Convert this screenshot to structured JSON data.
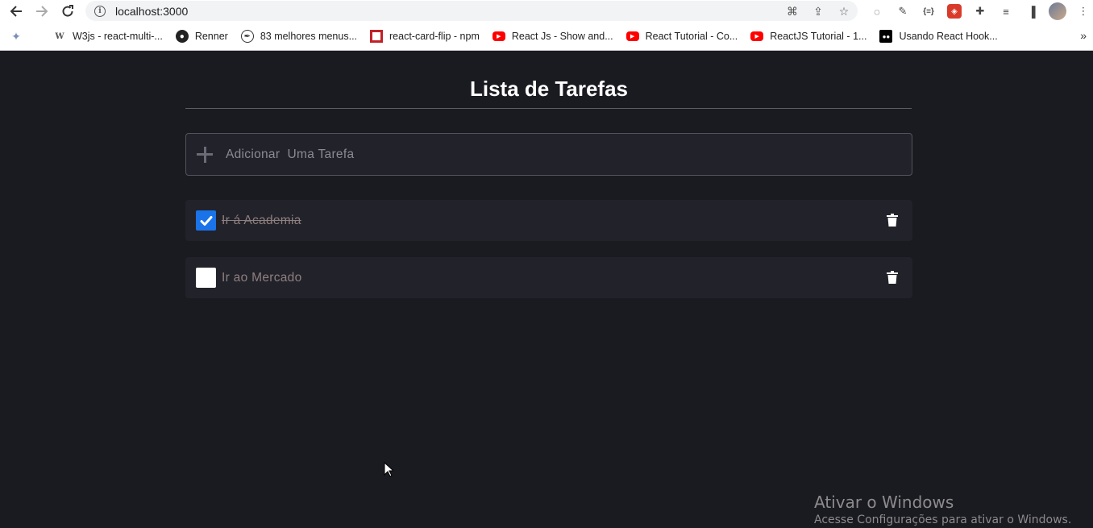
{
  "browser": {
    "url": "localhost:3000",
    "bookmarks": [
      {
        "label": "W3js - react-multi-...",
        "icon": "w3-icon"
      },
      {
        "label": "Renner",
        "icon": "globe-icon"
      },
      {
        "label": "83 melhores menus...",
        "icon": "feather-icon"
      },
      {
        "label": "react-card-flip - npm",
        "icon": "npm-icon"
      },
      {
        "label": "React Js - Show and...",
        "icon": "youtube-icon"
      },
      {
        "label": "React Tutorial - Co...",
        "icon": "youtube-icon"
      },
      {
        "label": "ReactJS Tutorial - 1...",
        "icon": "youtube-icon"
      },
      {
        "label": "Usando React Hook...",
        "icon": "medium-icon"
      }
    ]
  },
  "app": {
    "title": "Lista de Tarefas",
    "add_placeholder": "Adicionar  Uma Tarefa",
    "tasks": [
      {
        "label": "Ir á Academia",
        "done": true
      },
      {
        "label": "Ir ao Mercado",
        "done": false
      }
    ],
    "accent_color": "#1a73e8",
    "background_color": "#1a1a21"
  },
  "watermark": {
    "title": "Ativar o Windows",
    "subtitle": "Acesse Configurações para ativar o Windows."
  }
}
